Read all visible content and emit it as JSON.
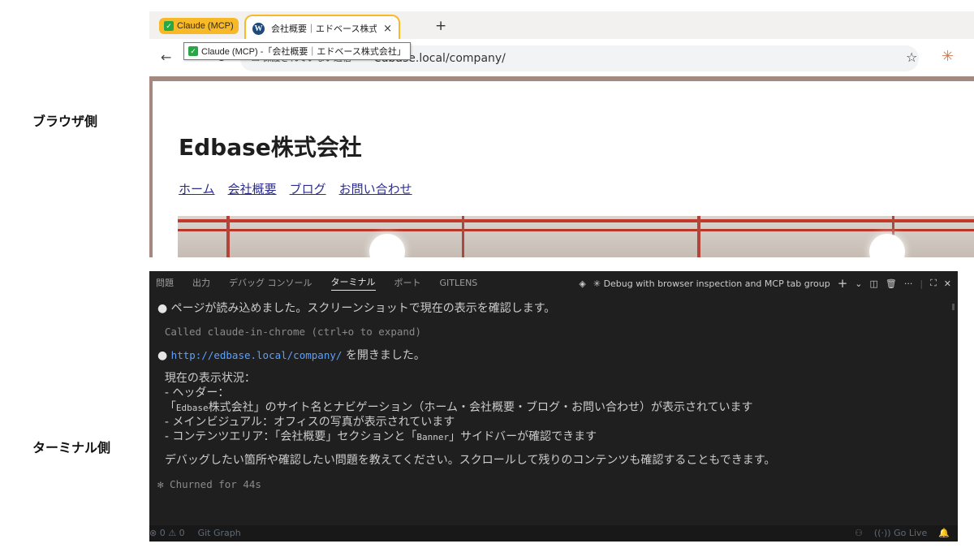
{
  "labels": {
    "browser_side": "ブラウザ側",
    "terminal_side": "ターミナル側"
  },
  "browser": {
    "tab_group_label": "Claude (MCP)",
    "tab_title": "会社概要｜エドベース株式会社",
    "tab_close": "×",
    "new_tab": "+",
    "tooltip": "Claude (MCP) -「会社概要｜エドベース株式会社」",
    "back": "←",
    "forward": "→",
    "reload": "↻",
    "security_text": "⚠ 保護されていない通信",
    "url": "edbase.local/company/",
    "star": "☆",
    "extension_icon": "✳"
  },
  "site": {
    "title": "Edbase株式会社",
    "nav": [
      "ホーム",
      "会社概要",
      "ブログ",
      "お問い合わせ"
    ]
  },
  "terminal": {
    "tabs": [
      "問題",
      "出力",
      "デバッグ コンソール",
      "ターミナル",
      "ポート",
      "GITLENS"
    ],
    "active_tab": "ターミナル",
    "session_title": "✳ Debug with browser inspection and MCP tab group",
    "bullet": "●",
    "line1": "ページが読み込めました。スクリーンショットで現在の表示を確認します。",
    "called": "Called claude-in-chrome (ctrl+o to expand)",
    "link": "http://edbase.local/company/",
    "link_suffix": " を開きました。",
    "status_heading": "現在の表示状況：",
    "header_item": "- ヘッダー：",
    "header_detail_prefix": "「",
    "header_detail_mono": "Edbase",
    "header_detail_rest": "株式会社」のサイト名とナビゲーション（ホーム・会社概要・ブログ・お問い合わせ）が表示されています",
    "main_visual": "- メインビジュアル：オフィスの写真が表示されています",
    "content_prefix": "- コンテンツエリア：「会社概要」セクションと「",
    "content_mono": "Banner",
    "content_suffix": "」サイドバーが確認できます",
    "closing": "デバッグしたい箇所や確認したい問題を教えてください。スクロールして残りのコンテンツも確認することもできます。",
    "churned": "✻ Churned for 44s"
  },
  "statusbar": {
    "errors": "⊗ 0",
    "warnings": "⚠ 0",
    "git_graph": "Git Graph",
    "go_live": "((·)) Go Live",
    "bell": "🔔"
  },
  "colors": {
    "tab_group": "#f7b928",
    "terminal_bg": "#1f1f1f",
    "link": "#5aa0ff",
    "nav_link": "#2d2d8c",
    "page_frame": "#a58880"
  }
}
